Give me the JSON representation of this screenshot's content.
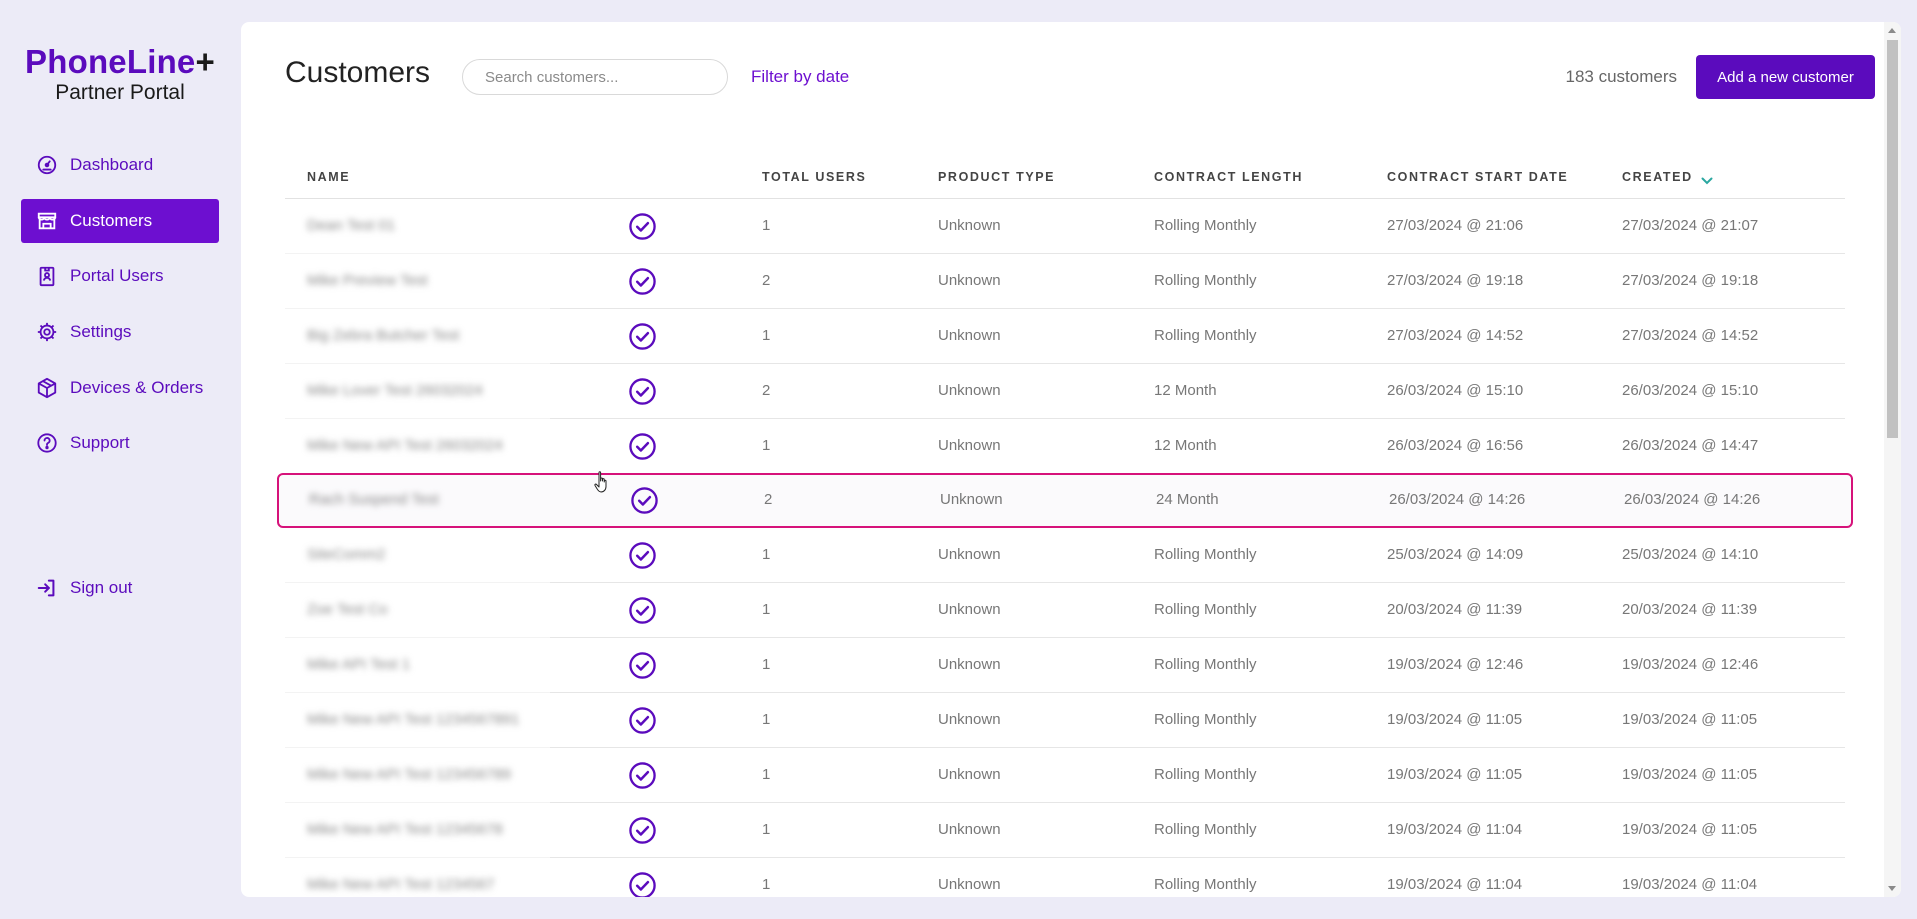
{
  "brand": {
    "name": "PhoneLine",
    "plus": "+",
    "subtitle": "Partner Portal"
  },
  "sidebar": {
    "items": [
      {
        "label": "Dashboard",
        "icon": "dashboard-gauge-icon",
        "active": false
      },
      {
        "label": "Customers",
        "icon": "storefront-icon",
        "active": true
      },
      {
        "label": "Portal Users",
        "icon": "id-badge-icon",
        "active": false
      },
      {
        "label": "Settings",
        "icon": "gear-icon",
        "active": false
      },
      {
        "label": "Devices & Orders",
        "icon": "package-box-icon",
        "active": false
      },
      {
        "label": "Support",
        "icon": "help-circle-icon",
        "active": false
      }
    ],
    "signout": {
      "label": "Sign out",
      "icon": "sign-out-icon"
    }
  },
  "header": {
    "title": "Customers",
    "search_placeholder": "Search customers...",
    "filter_label": "Filter by date",
    "count_label": "183 customers",
    "add_button_label": "Add a new customer"
  },
  "table": {
    "columns": {
      "name": "Name",
      "total_users": "Total Users",
      "product_type": "Product Type",
      "contract_length": "Contract Length",
      "contract_start": "Contract Start Date",
      "created": "Created"
    },
    "sort": {
      "column": "created",
      "direction": "desc"
    },
    "rows": [
      {
        "name": "Dean Test 01",
        "users": "1",
        "product": "Unknown",
        "length": "Rolling Monthly",
        "start": "27/03/2024 @ 21:06",
        "created": "27/03/2024 @ 21:07"
      },
      {
        "name": "Mike Preview Test",
        "users": "2",
        "product": "Unknown",
        "length": "Rolling Monthly",
        "start": "27/03/2024 @ 19:18",
        "created": "27/03/2024 @ 19:18"
      },
      {
        "name": "Big Zebra Butcher Test",
        "users": "1",
        "product": "Unknown",
        "length": "Rolling Monthly",
        "start": "27/03/2024 @ 14:52",
        "created": "27/03/2024 @ 14:52"
      },
      {
        "name": "Mike Lover Test 26032024",
        "users": "2",
        "product": "Unknown",
        "length": "12 Month",
        "start": "26/03/2024 @ 15:10",
        "created": "26/03/2024 @ 15:10"
      },
      {
        "name": "Mike New API Test 26032024",
        "users": "1",
        "product": "Unknown",
        "length": "12 Month",
        "start": "26/03/2024 @ 16:56",
        "created": "26/03/2024 @ 14:47"
      },
      {
        "name": "Rach Suspend Test",
        "users": "2",
        "product": "Unknown",
        "length": "24 Month",
        "start": "26/03/2024 @ 14:26",
        "created": "26/03/2024 @ 14:26",
        "highlight": true
      },
      {
        "name": "SiteComm2",
        "users": "1",
        "product": "Unknown",
        "length": "Rolling Monthly",
        "start": "25/03/2024 @ 14:09",
        "created": "25/03/2024 @ 14:10"
      },
      {
        "name": "Zoe Test Co",
        "users": "1",
        "product": "Unknown",
        "length": "Rolling Monthly",
        "start": "20/03/2024 @ 11:39",
        "created": "20/03/2024 @ 11:39"
      },
      {
        "name": "Mike API Test 1",
        "users": "1",
        "product": "Unknown",
        "length": "Rolling Monthly",
        "start": "19/03/2024 @ 12:46",
        "created": "19/03/2024 @ 12:46"
      },
      {
        "name": "Mike New API Test 1234567891",
        "users": "1",
        "product": "Unknown",
        "length": "Rolling Monthly",
        "start": "19/03/2024 @ 11:05",
        "created": "19/03/2024 @ 11:05"
      },
      {
        "name": "Mike New API Test 123456789",
        "users": "1",
        "product": "Unknown",
        "length": "Rolling Monthly",
        "start": "19/03/2024 @ 11:05",
        "created": "19/03/2024 @ 11:05"
      },
      {
        "name": "Mike New API Test 12345678",
        "users": "1",
        "product": "Unknown",
        "length": "Rolling Monthly",
        "start": "19/03/2024 @ 11:04",
        "created": "19/03/2024 @ 11:05"
      },
      {
        "name": "Mike New API Test 1234567",
        "users": "1",
        "product": "Unknown",
        "length": "Rolling Monthly",
        "start": "19/03/2024 @ 11:04",
        "created": "19/03/2024 @ 11:04"
      }
    ]
  },
  "colors": {
    "brand": "#5b0bbd",
    "active_nav": "#6d0fd0",
    "highlight_border": "#d6127a",
    "background": "#ecebf7"
  }
}
